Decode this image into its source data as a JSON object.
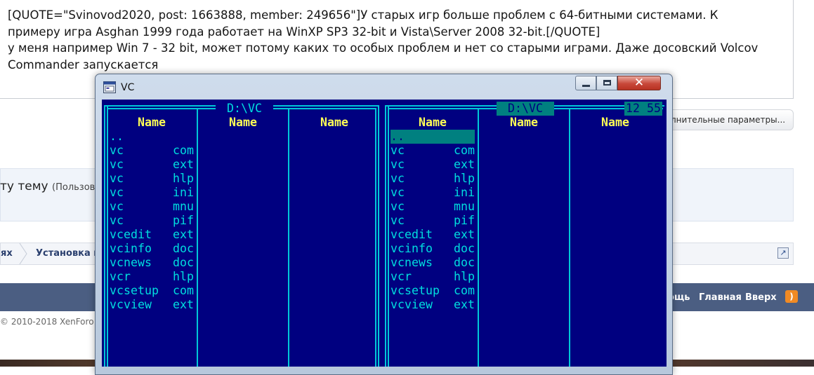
{
  "post": {
    "lines": [
      "[QUOTE=\"Svinovod2020, post: 1663888, member: 249656\"]У старых игр больше проблем с 64-битными системами. К",
      "примеру игра Asghan 1999 года работает на WinXP SP3 32-bit и Vista\\Server 2008 32-bit.[/QUOTE]",
      "у меня например Win 7 - 32 bit, может потому каких то особых проблем и нет со старыми играми.  Даже досовский Volcov",
      "Commander запускается"
    ]
  },
  "more_options_label": "лнительные параметры...",
  "reply": {
    "title": "ту тему",
    "hint": "(Пользов"
  },
  "breadcrumb": [
    "ях",
    "Установка и"
  ],
  "footer": {
    "links": [
      "ощь",
      "Главная",
      "Вверх"
    ],
    "copyright": "© 2010-2018 XenForo L"
  },
  "window": {
    "title": "VC",
    "close_glyph": "✕"
  },
  "vc": {
    "left_panel": {
      "path": " D:\\VC ",
      "headers": [
        "Name",
        "Name",
        "Name"
      ],
      "parent": "..",
      "files": [
        {
          "name": "vc",
          "ext": "com"
        },
        {
          "name": "vc",
          "ext": "ext"
        },
        {
          "name": "vc",
          "ext": "hlp"
        },
        {
          "name": "vc",
          "ext": "ini"
        },
        {
          "name": "vc",
          "ext": "mnu"
        },
        {
          "name": "vc",
          "ext": "pif"
        },
        {
          "name": "vcedit",
          "ext": "ext"
        },
        {
          "name": "vcinfo",
          "ext": "doc"
        },
        {
          "name": "vcnews",
          "ext": "doc"
        },
        {
          "name": "vcr",
          "ext": "hlp"
        },
        {
          "name": "vcsetup",
          "ext": "com"
        },
        {
          "name": "vcview",
          "ext": "ext"
        }
      ]
    },
    "right_panel": {
      "path": " D:\\VC ",
      "headers": [
        "Name",
        "Name",
        "Name"
      ],
      "parent": "..",
      "files": [
        {
          "name": "vc",
          "ext": "com"
        },
        {
          "name": "vc",
          "ext": "ext"
        },
        {
          "name": "vc",
          "ext": "hlp"
        },
        {
          "name": "vc",
          "ext": "ini"
        },
        {
          "name": "vc",
          "ext": "mnu"
        },
        {
          "name": "vc",
          "ext": "pif"
        },
        {
          "name": "vcedit",
          "ext": "ext"
        },
        {
          "name": "vcinfo",
          "ext": "doc"
        },
        {
          "name": "vcnews",
          "ext": "doc"
        },
        {
          "name": "vcr",
          "ext": "hlp"
        },
        {
          "name": "vcsetup",
          "ext": "com"
        },
        {
          "name": "vcview",
          "ext": "ext"
        }
      ]
    },
    "clock": "12 55"
  },
  "colors": {
    "console_bg": "#000080",
    "frame": "#00c8d8",
    "file_text": "#00dede",
    "header_text": "#ffff55",
    "selection": "#008080"
  }
}
